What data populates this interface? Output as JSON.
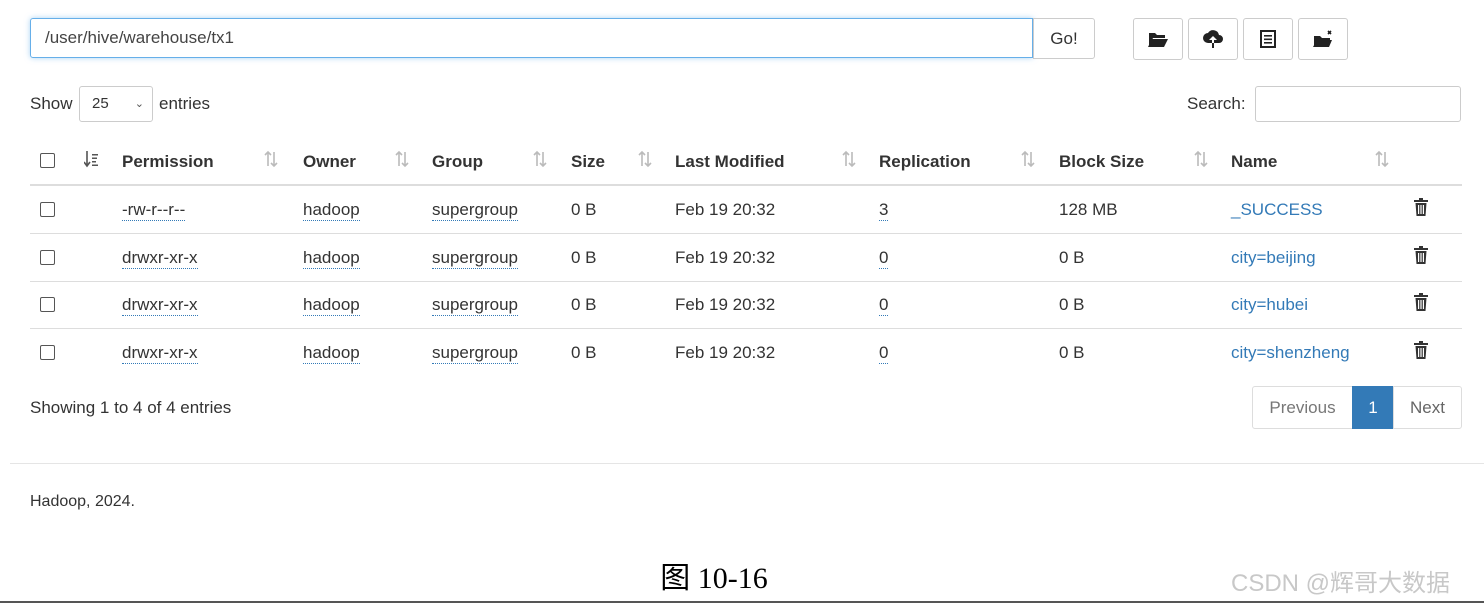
{
  "toolbar": {
    "path_value": "/user/hive/warehouse/tx1",
    "go_label": "Go!",
    "buttons": [
      "folder-open-icon",
      "upload-icon",
      "list-icon",
      "cut-paste-icon"
    ]
  },
  "controls": {
    "show_label": "Show",
    "entries_value": "25",
    "entries_label": "entries",
    "search_label": "Search:"
  },
  "table": {
    "columns": [
      "Permission",
      "Owner",
      "Group",
      "Size",
      "Last Modified",
      "Replication",
      "Block Size",
      "Name"
    ],
    "rows": [
      {
        "permission": "-rw-r--r--",
        "owner": "hadoop",
        "group": "supergroup",
        "size": "0 B",
        "modified": "Feb 19 20:32",
        "replication": "3",
        "block_size": "128 MB",
        "name": "_SUCCESS"
      },
      {
        "permission": "drwxr-xr-x",
        "owner": "hadoop",
        "group": "supergroup",
        "size": "0 B",
        "modified": "Feb 19 20:32",
        "replication": "0",
        "block_size": "0 B",
        "name": "city=beijing"
      },
      {
        "permission": "drwxr-xr-x",
        "owner": "hadoop",
        "group": "supergroup",
        "size": "0 B",
        "modified": "Feb 19 20:32",
        "replication": "0",
        "block_size": "0 B",
        "name": "city=hubei"
      },
      {
        "permission": "drwxr-xr-x",
        "owner": "hadoop",
        "group": "supergroup",
        "size": "0 B",
        "modified": "Feb 19 20:32",
        "replication": "0",
        "block_size": "0 B",
        "name": "city=shenzheng"
      }
    ]
  },
  "pagination": {
    "info": "Showing 1 to 4 of 4 entries",
    "previous": "Previous",
    "current": "1",
    "next": "Next"
  },
  "footer": {
    "text": "Hadoop, 2024."
  },
  "caption": "图 10-16",
  "watermark": "CSDN @辉哥大数据",
  "colors": {
    "link": "#337ab7",
    "active_page": "#337ab7",
    "focus": "#66afe9"
  }
}
